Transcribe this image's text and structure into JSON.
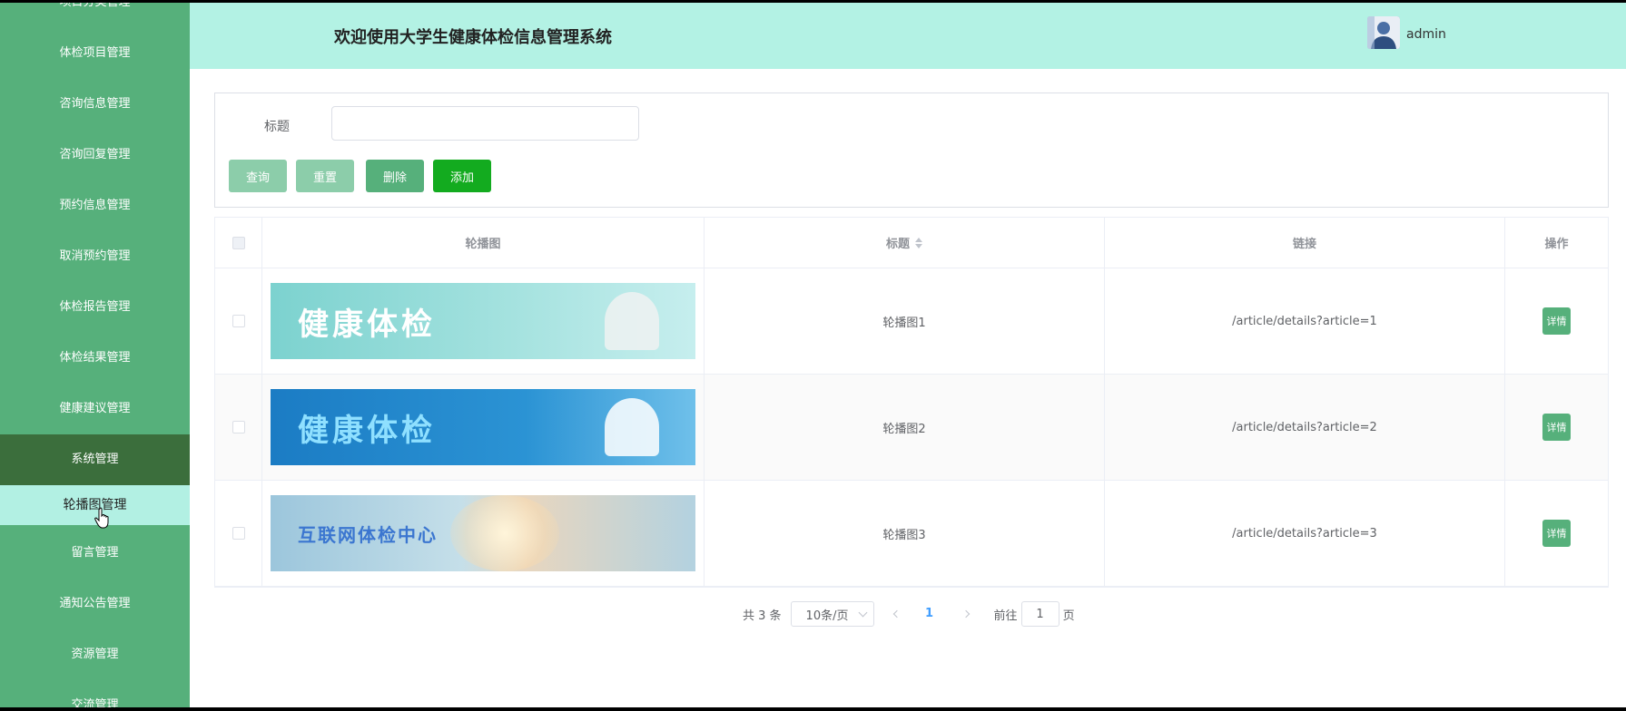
{
  "header": {
    "title": "欢迎使用大学生健康体检信息管理系统",
    "user": "admin"
  },
  "sidebar": {
    "items": [
      {
        "label": "项目分类管理"
      },
      {
        "label": "体检项目管理"
      },
      {
        "label": "咨询信息管理"
      },
      {
        "label": "咨询回复管理"
      },
      {
        "label": "预约信息管理"
      },
      {
        "label": "取消预约管理"
      },
      {
        "label": "体检报告管理"
      },
      {
        "label": "体检结果管理"
      },
      {
        "label": "健康建议管理"
      },
      {
        "label": "系统管理"
      },
      {
        "label": "轮播图管理"
      },
      {
        "label": "留言管理"
      },
      {
        "label": "通知公告管理"
      },
      {
        "label": "资源管理"
      },
      {
        "label": "交流管理"
      }
    ]
  },
  "search": {
    "label": "标题",
    "placeholder": "",
    "value": "",
    "buttons": {
      "query": "查询",
      "reset": "重置",
      "delete": "删除",
      "add": "添加"
    }
  },
  "table": {
    "columns": [
      "轮播图",
      "标题",
      "链接",
      "操作"
    ],
    "rows": [
      {
        "banner_text": "健康体检",
        "title": "轮播图1",
        "link": "/article/details?article=1",
        "action": "详情"
      },
      {
        "banner_text": "健康体检",
        "title": "轮播图2",
        "link": "/article/details?article=2",
        "action": "详情"
      },
      {
        "banner_text": "互联网体检中心",
        "title": "轮播图3",
        "link": "/article/details?article=3",
        "action": "详情"
      }
    ]
  },
  "pagination": {
    "total": "共 3 条",
    "page_size": "10条/页",
    "current_page": "1",
    "goto_prefix": "前往",
    "goto_value": "1",
    "goto_suffix": "页"
  },
  "colors": {
    "sidebar": "#56b07b",
    "sidebar_group": "#3b6e3c",
    "header": "#b3f2e4",
    "accent": "#56b07b",
    "add_button": "#13ab1f",
    "page_active": "#409eff"
  }
}
